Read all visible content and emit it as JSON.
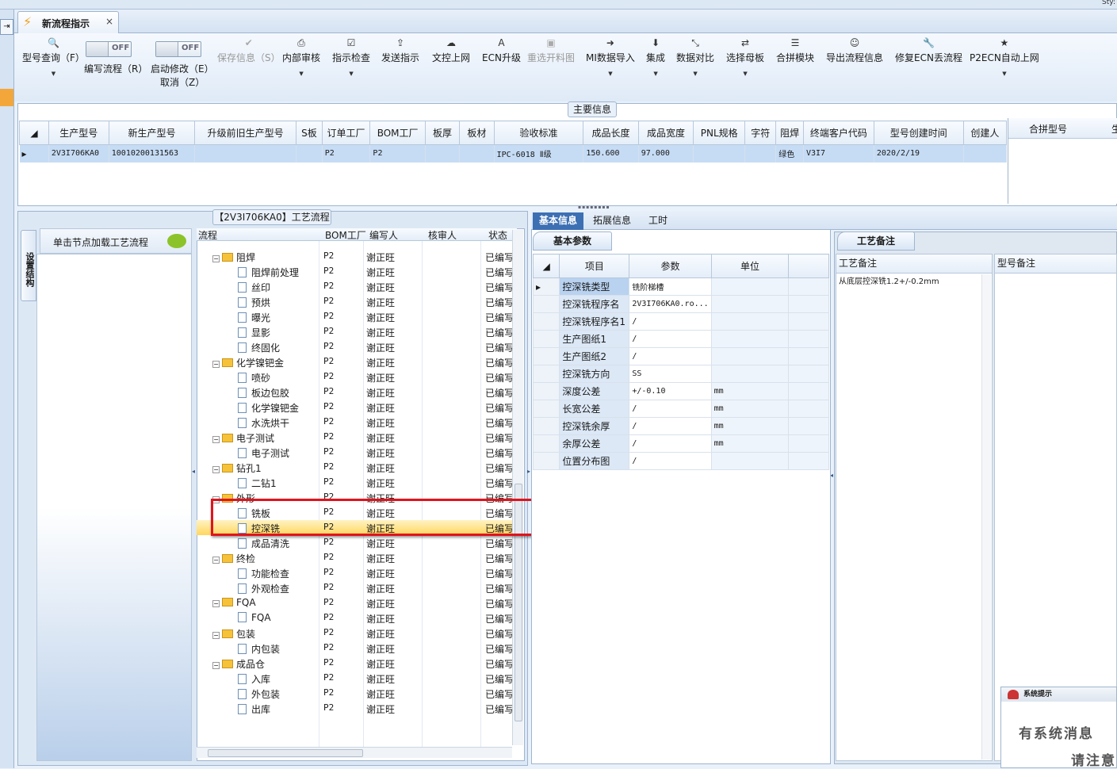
{
  "window": {
    "corner_text": "Sty:"
  },
  "tab": {
    "title": "新流程指示",
    "close": "×"
  },
  "toolbar": {
    "model_query": "型号查询（F）",
    "write_flow": "编写流程（R）",
    "start_modify": "启动修改（E）",
    "cancel": "取消（Z）",
    "toggle_off": "OFF",
    "save_info": "保存信息（S）",
    "internal_review": "内部审核",
    "instruction_check": "指示检查",
    "send_instruction": "发送指示",
    "doc_upload": "文控上网",
    "ecn_upgrade": "ECN升级",
    "reselect_material": "重选开料图",
    "mi_import": "MI数据导入",
    "integrate": "集成",
    "data_compare": "数据对比",
    "select_master": "选择母板",
    "merge_module": "合拼模块",
    "export_flow": "导出流程信息",
    "fix_ecn": "修复ECN丢流程",
    "p2ecn": "P2ECN自动上网"
  },
  "main_info": {
    "label": "主要信息",
    "columns": [
      "生产型号",
      "新生产型号",
      "升级前旧生产型号",
      "S板",
      "订单工厂",
      "BOM工厂",
      "板厚",
      "板材",
      "验收标准",
      "成品长度",
      "成品宽度",
      "PNL规格",
      "字符",
      "阻焊",
      "终端客户代码",
      "型号创建时间",
      "创建人"
    ],
    "row": [
      "2V3I706KA0",
      "10010200131563",
      "",
      "",
      "P2",
      "P2",
      "",
      "",
      "IPC-6018 Ⅱ级",
      "150.600",
      "97.000",
      "",
      "",
      "绿色",
      "V3I7",
      "2020/2/19",
      ""
    ],
    "right_columns": [
      "合拼型号",
      "生"
    ]
  },
  "flow_panel": {
    "title": "【2V3I706KA0】工艺流程",
    "vertical_tab": "设置结构",
    "node_hint": "单击节点加载工艺流程",
    "columns": {
      "flow": "流程",
      "bom": "BOM工厂",
      "writer": "编写人",
      "reviewer": "核审人",
      "status": "状态"
    },
    "rows": [
      {
        "level": 0,
        "type": "folder",
        "name": "阻焊",
        "bom": "P2",
        "writer": "谢正旺",
        "status": "已编写"
      },
      {
        "level": 1,
        "type": "doc",
        "name": "阻焊前处理",
        "bom": "P2",
        "writer": "谢正旺",
        "status": "已编写"
      },
      {
        "level": 1,
        "type": "doc",
        "name": "丝印",
        "bom": "P2",
        "writer": "谢正旺",
        "status": "已编写"
      },
      {
        "level": 1,
        "type": "doc",
        "name": "预烘",
        "bom": "P2",
        "writer": "谢正旺",
        "status": "已编写"
      },
      {
        "level": 1,
        "type": "doc",
        "name": "曝光",
        "bom": "P2",
        "writer": "谢正旺",
        "status": "已编写"
      },
      {
        "level": 1,
        "type": "doc",
        "name": "显影",
        "bom": "P2",
        "writer": "谢正旺",
        "status": "已编写"
      },
      {
        "level": 1,
        "type": "doc",
        "name": "终固化",
        "bom": "P2",
        "writer": "谢正旺",
        "status": "已编写"
      },
      {
        "level": 0,
        "type": "folder",
        "name": "化学镍钯金",
        "bom": "P2",
        "writer": "谢正旺",
        "status": "已编写"
      },
      {
        "level": 1,
        "type": "doc",
        "name": "喷砂",
        "bom": "P2",
        "writer": "谢正旺",
        "status": "已编写"
      },
      {
        "level": 1,
        "type": "doc",
        "name": "板边包胶",
        "bom": "P2",
        "writer": "谢正旺",
        "status": "已编写"
      },
      {
        "level": 1,
        "type": "doc",
        "name": "化学镍钯金",
        "bom": "P2",
        "writer": "谢正旺",
        "status": "已编写"
      },
      {
        "level": 1,
        "type": "doc",
        "name": "水洗烘干",
        "bom": "P2",
        "writer": "谢正旺",
        "status": "已编写"
      },
      {
        "level": 0,
        "type": "folder",
        "name": "电子测试",
        "bom": "P2",
        "writer": "谢正旺",
        "status": "已编写"
      },
      {
        "level": 1,
        "type": "doc",
        "name": "电子测试",
        "bom": "P2",
        "writer": "谢正旺",
        "status": "已编写"
      },
      {
        "level": 0,
        "type": "folder",
        "name": "钻孔1",
        "bom": "P2",
        "writer": "谢正旺",
        "status": "已编写"
      },
      {
        "level": 1,
        "type": "doc",
        "name": "二钻1",
        "bom": "P2",
        "writer": "谢正旺",
        "status": "已编写"
      },
      {
        "level": 0,
        "type": "folder",
        "name": "外形",
        "bom": "P2",
        "writer": "谢正旺",
        "status": "已编写"
      },
      {
        "level": 1,
        "type": "doc",
        "name": "铣板",
        "bom": "P2",
        "writer": "谢正旺",
        "status": "已编写"
      },
      {
        "level": 1,
        "type": "doc",
        "name": "控深铣",
        "bom": "P2",
        "writer": "谢正旺",
        "status": "已编写",
        "selected": true
      },
      {
        "level": 1,
        "type": "doc",
        "name": "成品清洗",
        "bom": "P2",
        "writer": "谢正旺",
        "status": "已编写"
      },
      {
        "level": 0,
        "type": "folder",
        "name": "终检",
        "bom": "P2",
        "writer": "谢正旺",
        "status": "已编写"
      },
      {
        "level": 1,
        "type": "doc",
        "name": "功能检查",
        "bom": "P2",
        "writer": "谢正旺",
        "status": "已编写"
      },
      {
        "level": 1,
        "type": "doc",
        "name": "外观检查",
        "bom": "P2",
        "writer": "谢正旺",
        "status": "已编写"
      },
      {
        "level": 0,
        "type": "folder",
        "name": "FQA",
        "bom": "P2",
        "writer": "谢正旺",
        "status": "已编写"
      },
      {
        "level": 1,
        "type": "doc",
        "name": "FQA",
        "bom": "P2",
        "writer": "谢正旺",
        "status": "已编写"
      },
      {
        "level": 0,
        "type": "folder",
        "name": "包装",
        "bom": "P2",
        "writer": "谢正旺",
        "status": "已编写"
      },
      {
        "level": 1,
        "type": "doc",
        "name": "内包装",
        "bom": "P2",
        "writer": "谢正旺",
        "status": "已编写"
      },
      {
        "level": 0,
        "type": "folder",
        "name": "成品仓",
        "bom": "P2",
        "writer": "谢正旺",
        "status": "已编写"
      },
      {
        "level": 1,
        "type": "doc",
        "name": "入库",
        "bom": "P2",
        "writer": "谢正旺",
        "status": "已编写"
      },
      {
        "level": 1,
        "type": "doc",
        "name": "外包装",
        "bom": "P2",
        "writer": "谢正旺",
        "status": "已编写"
      },
      {
        "level": 1,
        "type": "doc",
        "name": "出库",
        "bom": "P2",
        "writer": "谢正旺",
        "status": "已编写"
      }
    ]
  },
  "detail_tabs": [
    "基本信息",
    "拓展信息",
    "工时"
  ],
  "basic_params": {
    "title": "基本参数",
    "columns": [
      "项目",
      "参数",
      "单位"
    ],
    "rows": [
      {
        "item": "控深铣类型",
        "value": "铣阶梯槽",
        "unit": ""
      },
      {
        "item": "控深铣程序名",
        "value": "2V3I706KA0.ro...",
        "unit": ""
      },
      {
        "item": "控深铣程序名1",
        "value": "/",
        "unit": ""
      },
      {
        "item": "生产图纸1",
        "value": "/",
        "unit": ""
      },
      {
        "item": "生产图纸2",
        "value": "/",
        "unit": ""
      },
      {
        "item": "控深铣方向",
        "value": "SS",
        "unit": ""
      },
      {
        "item": "深度公差",
        "value": "+/-0.10",
        "unit": "mm"
      },
      {
        "item": "长宽公差",
        "value": "/",
        "unit": "mm"
      },
      {
        "item": "控深铣余厚",
        "value": "/",
        "unit": "mm"
      },
      {
        "item": "余厚公差",
        "value": "/",
        "unit": "mm"
      },
      {
        "item": "位置分布图",
        "value": "/",
        "unit": ""
      }
    ]
  },
  "process_notes": {
    "title": "工艺备注",
    "col1": "工艺备注",
    "col2": "型号备注",
    "text": "从底层控深铣1.2+/-0.2mm"
  },
  "system_message": {
    "title": "系统提示",
    "line1": "有系统消息",
    "line2": "请注意"
  }
}
